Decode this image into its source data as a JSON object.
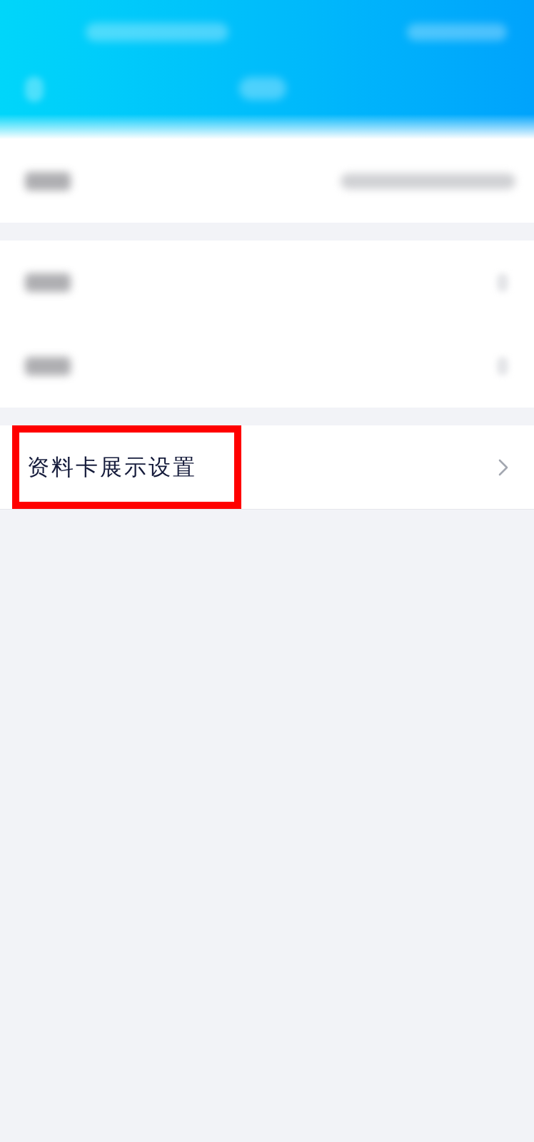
{
  "header": {
    "status_bar": [
      {
        "kind": "blurred"
      },
      {
        "kind": "blurred"
      }
    ],
    "nav": {
      "back": {
        "kind": "blurred"
      },
      "title": {
        "kind": "blurred"
      }
    }
  },
  "sections": [
    {
      "rows": [
        {
          "label": {
            "kind": "blurred"
          },
          "trailing": {
            "kind": "blurred_value"
          },
          "highlighted": false
        }
      ]
    },
    {
      "rows": [
        {
          "label": {
            "kind": "blurred"
          },
          "trailing": {
            "kind": "blurred_chevron"
          },
          "highlighted": false
        },
        {
          "label": {
            "kind": "blurred"
          },
          "trailing": {
            "kind": "blurred_chevron"
          },
          "highlighted": false
        }
      ]
    },
    {
      "rows": [
        {
          "label": {
            "kind": "text",
            "text": "资料卡展示设置"
          },
          "trailing": {
            "kind": "chevron"
          },
          "highlighted": true
        }
      ]
    }
  ]
}
